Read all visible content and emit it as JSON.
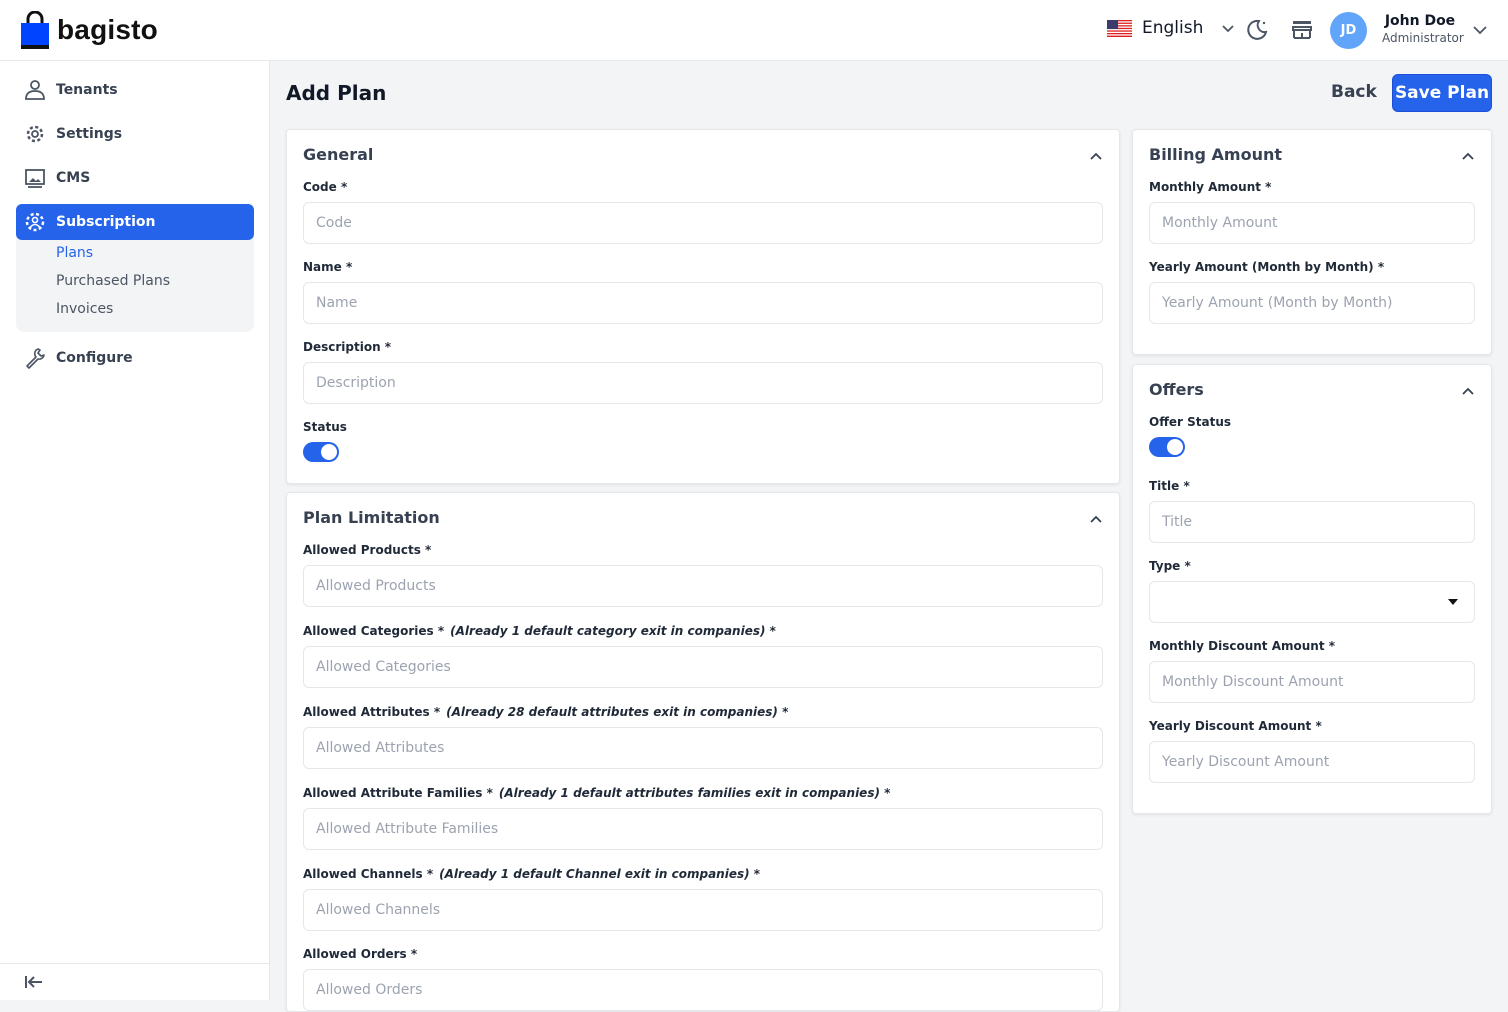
{
  "app": {
    "brand": "bagisto"
  },
  "header": {
    "language": "English",
    "user": {
      "initials": "JD",
      "name": "John Doe",
      "role": "Administrator"
    }
  },
  "sidebar": {
    "items": [
      {
        "label": "Tenants",
        "icon": "user-icon"
      },
      {
        "label": "Settings",
        "icon": "gear-icon"
      },
      {
        "label": "CMS",
        "icon": "monitor-image-icon"
      },
      {
        "label": "Subscription",
        "icon": "users-gear-icon",
        "active": true
      },
      {
        "label": "Configure",
        "icon": "wrench-icon"
      }
    ],
    "subitems": [
      {
        "label": "Plans",
        "active": true
      },
      {
        "label": "Purchased Plans"
      },
      {
        "label": "Invoices"
      }
    ]
  },
  "page": {
    "title": "Add Plan",
    "back_label": "Back",
    "save_label": "Save Plan"
  },
  "general": {
    "title": "General",
    "code": {
      "label": "Code *",
      "placeholder": "Code",
      "value": ""
    },
    "name": {
      "label": "Name *",
      "placeholder": "Name",
      "value": ""
    },
    "description": {
      "label": "Description *",
      "placeholder": "Description",
      "value": ""
    },
    "status": {
      "label": "Status",
      "on": true
    }
  },
  "limitation": {
    "title": "Plan Limitation",
    "products": {
      "label": "Allowed Products *",
      "placeholder": "Allowed Products"
    },
    "categories": {
      "label": "Allowed Categories *",
      "hint": "(Already 1 default category exit in companies) *",
      "placeholder": "Allowed Categories"
    },
    "attributes": {
      "label": "Allowed Attributes *",
      "hint": "(Already 28 default attributes exit in companies) *",
      "placeholder": "Allowed Attributes"
    },
    "families": {
      "label": "Allowed Attribute Families *",
      "hint": "(Already 1 default attributes families exit in companies) *",
      "placeholder": "Allowed Attribute Families"
    },
    "channels": {
      "label": "Allowed Channels *",
      "hint": "(Already 1 default Channel exit in companies) *",
      "placeholder": "Allowed Channels"
    },
    "orders": {
      "label": "Allowed Orders *",
      "placeholder": "Allowed Orders"
    }
  },
  "billing": {
    "title": "Billing Amount",
    "monthly": {
      "label": "Monthly Amount *",
      "placeholder": "Monthly Amount"
    },
    "yearly": {
      "label": "Yearly Amount (Month by Month) *",
      "placeholder": "Yearly Amount (Month by Month)"
    }
  },
  "offers": {
    "title": "Offers",
    "status": {
      "label": "Offer Status",
      "on": true
    },
    "title_field": {
      "label": "Title *",
      "placeholder": "Title"
    },
    "type": {
      "label": "Type *",
      "value": ""
    },
    "monthly_discount": {
      "label": "Monthly Discount Amount *",
      "placeholder": "Monthly Discount Amount"
    },
    "yearly_discount": {
      "label": "Yearly Discount Amount *",
      "placeholder": "Yearly Discount Amount"
    }
  },
  "colors": {
    "accent": "#2563eb",
    "avatar": "#60a5fa"
  }
}
